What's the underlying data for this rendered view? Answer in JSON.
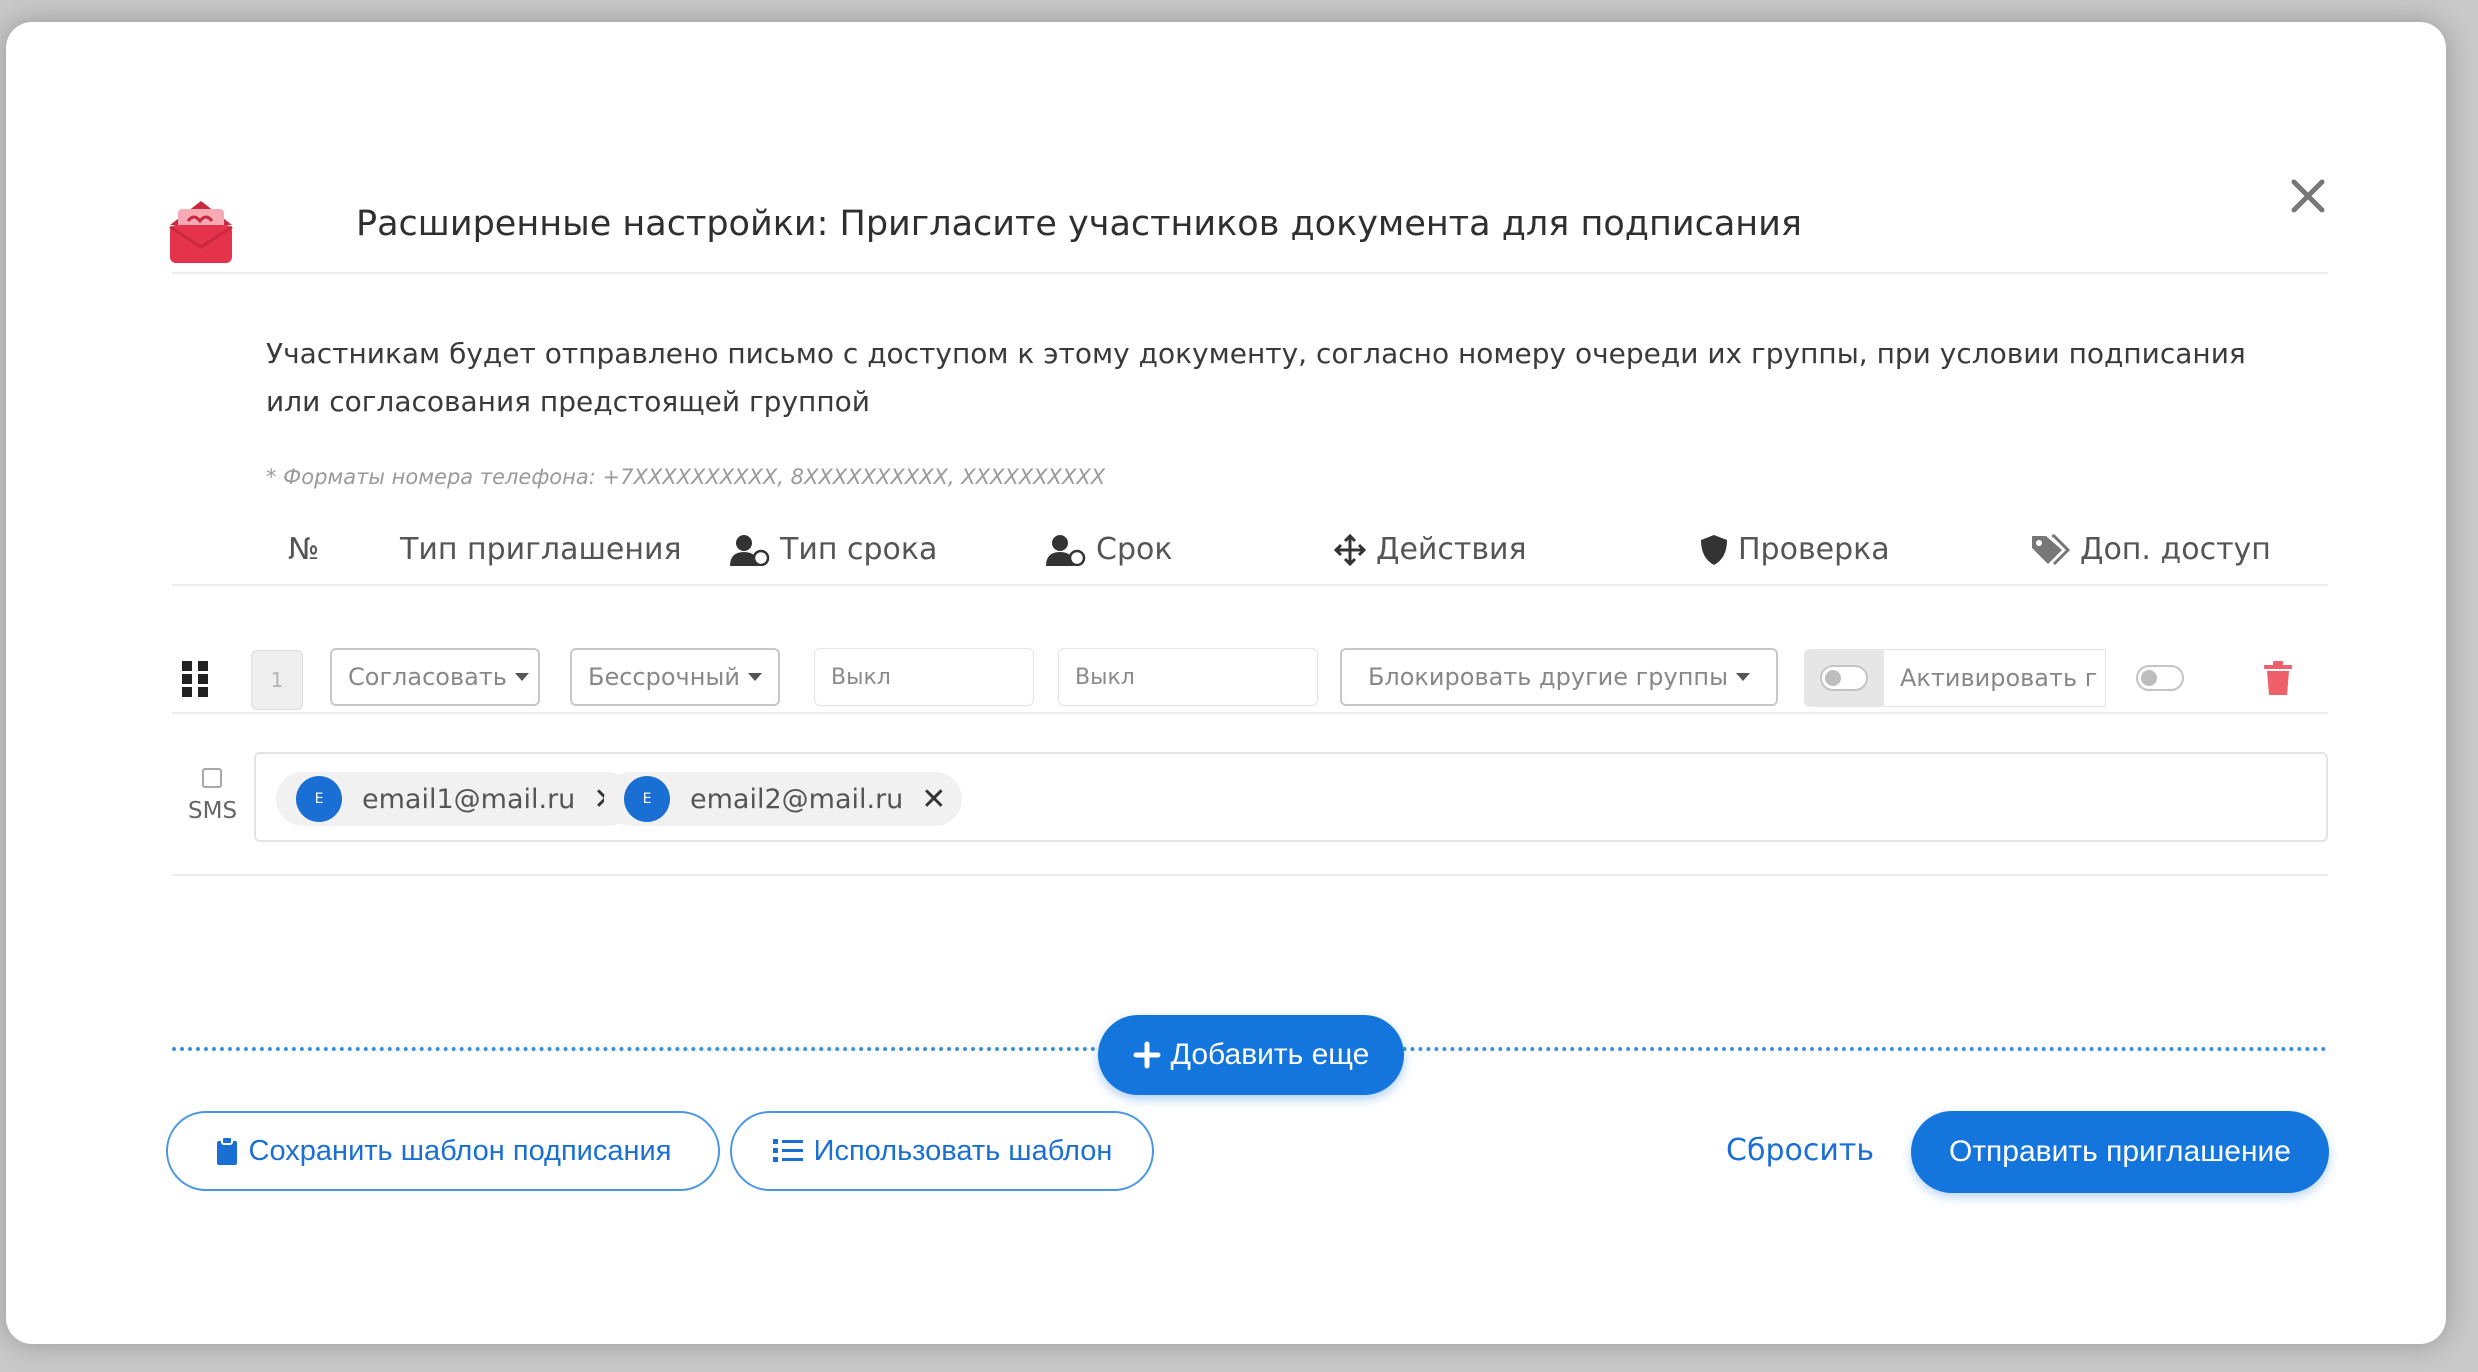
{
  "modal": {
    "title": "Расширенные настройки: Пригласите участников документа для подписания",
    "description": "Участникам будет отправлено письмо с доступом к этому документу, согласно номеру очереди их группы, при условии подписания или согласования предстоящей группой",
    "phone_note": "* Форматы номера телефона: +7XXXXXXXXXX, 8XXXXXXXXXX, XXXXXXXXXX"
  },
  "columns": {
    "number": "№",
    "invite_type": "Тип приглашения",
    "term_type": "Тип срока",
    "term": "Срок",
    "actions": "Действия",
    "verification": "Проверка",
    "extra_access": "Доп. доступ"
  },
  "row": {
    "order": "1",
    "invite_type": "Согласовать",
    "term_type": "Бессрочный",
    "term_type_value": "Выкл",
    "term_value": "Выкл",
    "action": "Блокировать другие группы",
    "activate": "Активировать г",
    "sms_label": "SMS",
    "emails": [
      {
        "avatar": "E",
        "email": "email1@mail.ru"
      },
      {
        "avatar": "E",
        "email": "email2@mail.ru"
      }
    ]
  },
  "buttons": {
    "add_more": "Добавить еще",
    "save_template": "Сохранить шаблон подписания",
    "use_template": "Использовать шаблон",
    "reset": "Сбросить",
    "send": "Отправить приглашение"
  },
  "colors": {
    "accent": "#1475dc",
    "logo": "#e5334b",
    "trash": "#f0606a"
  }
}
